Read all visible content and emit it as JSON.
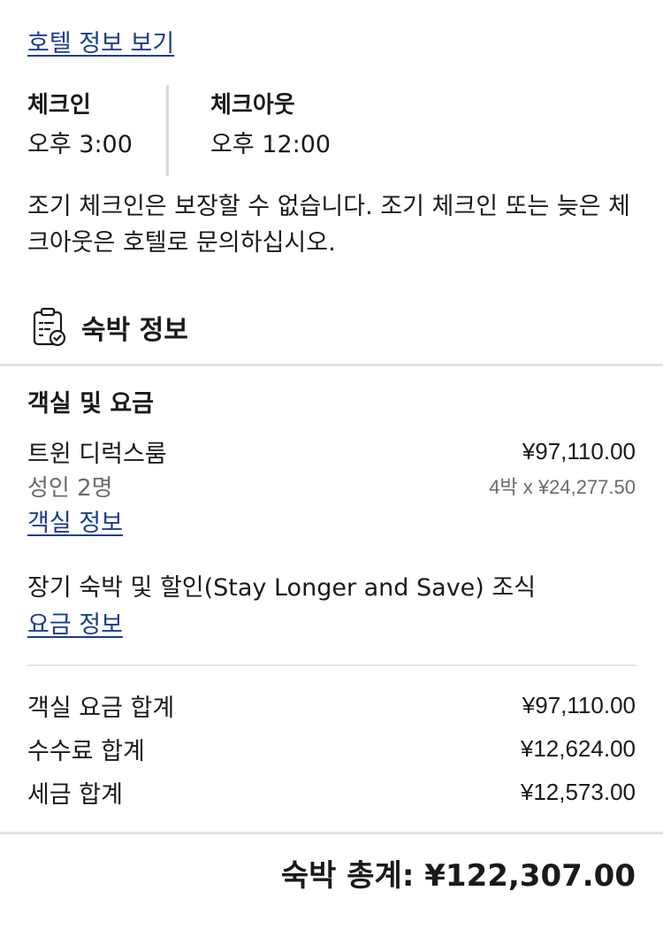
{
  "hotel_info_link": "호텔 정보 보기",
  "checkin": {
    "label": "체크인",
    "time": "오후 3:00"
  },
  "checkout": {
    "label": "체크아웃",
    "time": "오후 12:00"
  },
  "early_checkin_note": "조기 체크인은 보장할 수 없습니다. 조기 체크인 또는 늦은 체크아웃은 호텔로 문의하십시오.",
  "stay_info": {
    "title": "숙박 정보",
    "icon": "clipboard-check-icon"
  },
  "room_and_rate": {
    "title": "객실 및 요금",
    "room_name": "트윈 디럭스룸",
    "room_price": "¥97,110.00",
    "guests": "성인 2명",
    "nightly_breakdown": "4박 x ¥24,277.50",
    "room_info_link": "객실 정보",
    "rate_name": "장기 숙박 및 할인(Stay Longer and Save) 조식",
    "rate_info_link": "요금 정보"
  },
  "summary": [
    {
      "label": "객실 요금 합계",
      "value": "¥97,110.00"
    },
    {
      "label": "수수료 합계",
      "value": "¥12,624.00"
    },
    {
      "label": "세금 합계",
      "value": "¥12,573.00"
    }
  ],
  "total": "숙박 총계: ¥122,307.00",
  "colors": {
    "link": "#1c3d8f",
    "muted": "#6b6b6b",
    "divider": "#e2e2e2"
  }
}
